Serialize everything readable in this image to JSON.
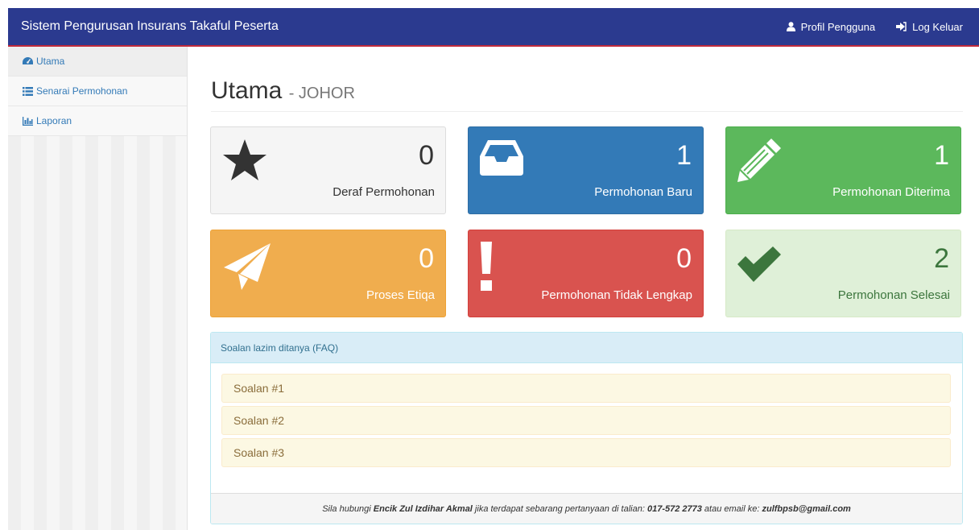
{
  "header": {
    "brand": "Sistem Pengurusan Insurans Takaful Peserta",
    "profile_label": "Profil Pengguna",
    "logout_label": "Log Keluar"
  },
  "sidebar": {
    "items": [
      {
        "label": "Utama",
        "icon": "dashboard-icon"
      },
      {
        "label": "Senarai Permohonan",
        "icon": "list-icon"
      },
      {
        "label": "Laporan",
        "icon": "bar-chart-icon"
      }
    ]
  },
  "page": {
    "title": "Utama",
    "subtitle": "- JOHOR"
  },
  "cards": [
    {
      "count": "0",
      "label": "Deraf Permohonan",
      "icon": "star-icon",
      "color": "#f5f5f5"
    },
    {
      "count": "1",
      "label": "Permohonan Baru",
      "icon": "inbox-icon",
      "color": "#337ab7"
    },
    {
      "count": "1",
      "label": "Permohonan Diterima",
      "icon": "pencil-icon",
      "color": "#5cb85c"
    },
    {
      "count": "0",
      "label": "Proses Etiqa",
      "icon": "paper-plane-icon",
      "color": "#f0ad4e"
    },
    {
      "count": "0",
      "label": "Permohonan Tidak Lengkap",
      "icon": "exclamation-icon",
      "color": "#d9534f"
    },
    {
      "count": "2",
      "label": "Permohonan Selesai",
      "icon": "check-icon",
      "color": "#dff0d8"
    }
  ],
  "faq": {
    "heading": "Soalan lazim ditanya (FAQ)",
    "items": [
      "Soalan #1",
      "Soalan #2",
      "Soalan #3"
    ],
    "footer": {
      "prefix": "Sila hubungi ",
      "contact_name": "Encik Zul Izdihar Akmal",
      "middle": " jika terdapat sebarang pertanyaan di talian: ",
      "phone": "017-572 2773",
      "email_prefix": " atau email ke: ",
      "email": "zulfbpsb@gmail.com"
    }
  }
}
